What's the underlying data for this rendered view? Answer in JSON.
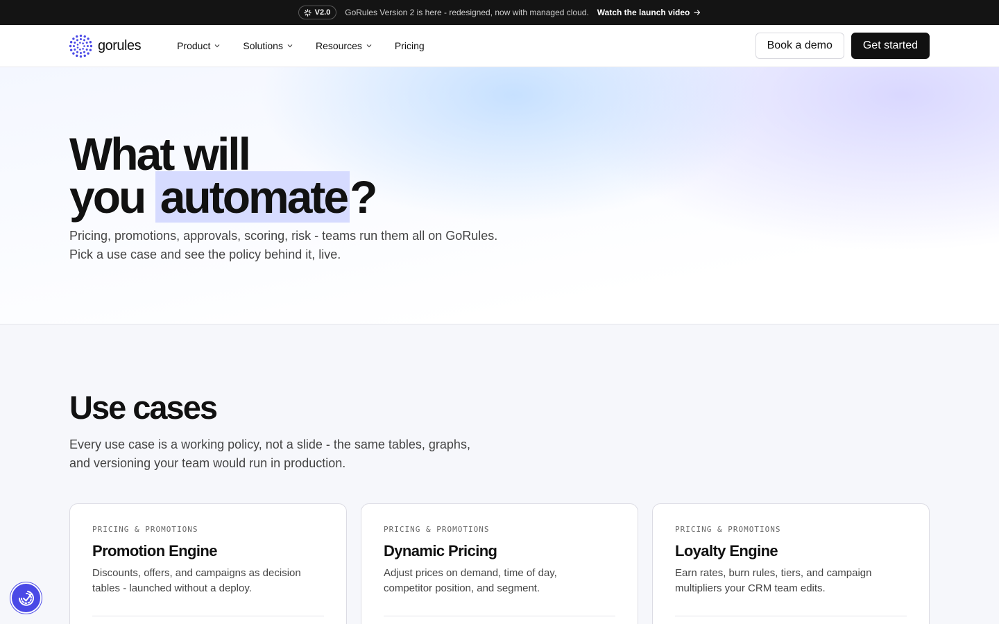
{
  "announcement": {
    "badge": "V2.0",
    "message": "GoRules Version 2 is here - redesigned, now with managed cloud.",
    "link": "Watch the launch video"
  },
  "nav": {
    "logo_text": "gorules",
    "items": [
      "Product",
      "Solutions",
      "Resources",
      "Pricing"
    ],
    "book_demo": "Book a demo",
    "get_started": "Get started"
  },
  "hero": {
    "title_line1": "What will",
    "title_line2_pre": "you ",
    "title_highlight": "automate",
    "title_line2_post": "?",
    "subtitle_line1": "Pricing, promotions, approvals, scoring, risk - teams run them all on GoRules.",
    "subtitle_line2": "Pick a use case and see the policy behind it, live."
  },
  "use_cases": {
    "title": "Use cases",
    "subtitle_line1": "Every use case is a working policy, not a slide - the same tables, graphs,",
    "subtitle_line2": "and versioning your team would run in production.",
    "cards": [
      {
        "eyebrow": "PRICING & PROMOTIONS",
        "title": "Promotion Engine",
        "desc_line1": "Discounts, offers, and campaigns as decision",
        "desc_line2": "tables - launched without a deploy."
      },
      {
        "eyebrow": "PRICING & PROMOTIONS",
        "title": "Dynamic Pricing",
        "desc_line1": "Adjust prices on demand, time of day,",
        "desc_line2": "competitor position, and segment."
      },
      {
        "eyebrow": "PRICING & PROMOTIONS",
        "title": "Loyalty Engine",
        "desc_line1": "Earn rates, burn rules, tiers, and campaign",
        "desc_line2": "multipliers your CRM team edits."
      }
    ]
  },
  "colors": {
    "brand": "#4a49e6",
    "highlight": "#d6dbff",
    "dark": "#111111"
  },
  "icons": {
    "badge": "sparkle-icon",
    "link_arrow": "arrow-right-icon",
    "chevron": "chevron-down-icon",
    "fab": "accessibility-icon"
  }
}
